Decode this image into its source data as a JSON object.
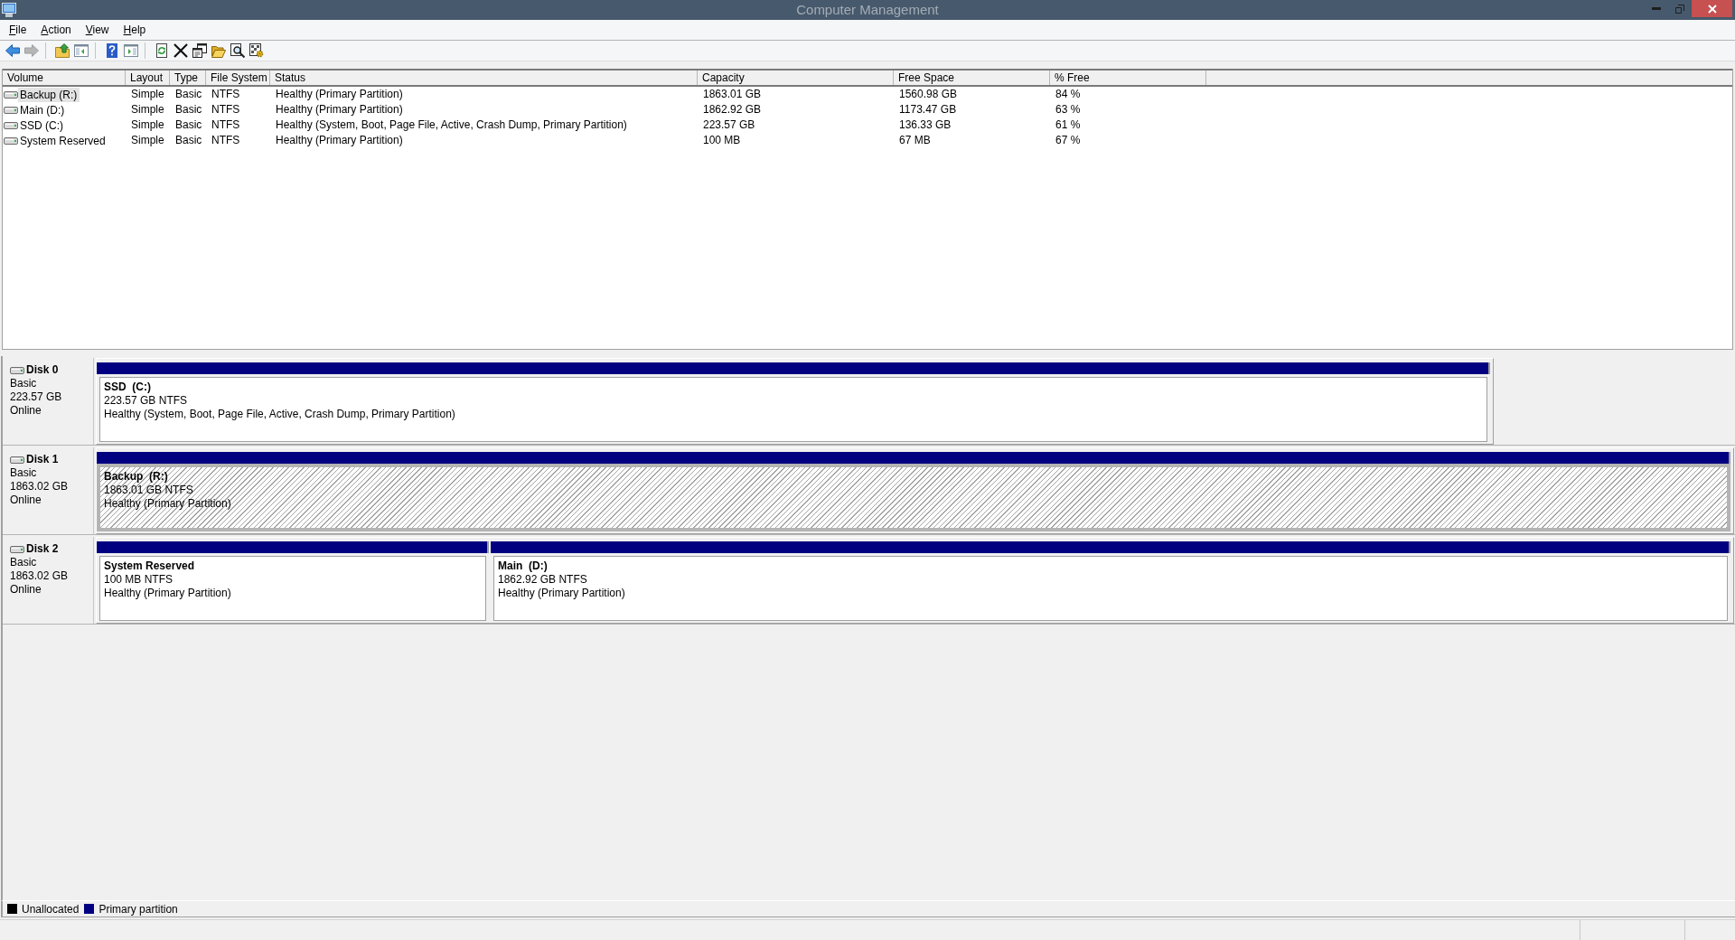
{
  "window": {
    "title": "Computer Management"
  },
  "menu": [
    {
      "label": "File"
    },
    {
      "label": "Action"
    },
    {
      "label": "View"
    },
    {
      "label": "Help"
    }
  ],
  "toolbar": {
    "groups": [
      [
        {
          "kind": "back",
          "disabled": false
        },
        {
          "kind": "forward",
          "disabled": true
        }
      ],
      [
        {
          "kind": "up",
          "disabled": false
        },
        {
          "kind": "console_tree",
          "disabled": false
        }
      ],
      [
        {
          "kind": "help",
          "disabled": false
        },
        {
          "kind": "action_pane",
          "disabled": false
        }
      ],
      [
        {
          "kind": "refresh",
          "disabled": false
        },
        {
          "kind": "delete",
          "disabled": false
        },
        {
          "kind": "properties",
          "disabled": false
        },
        {
          "kind": "open",
          "disabled": false
        },
        {
          "kind": "find",
          "disabled": false
        },
        {
          "kind": "options",
          "disabled": false
        }
      ]
    ]
  },
  "volume_table": {
    "columns": [
      "Volume",
      "Layout",
      "Type",
      "File System",
      "Status",
      "Capacity",
      "Free Space",
      "% Free"
    ],
    "rows": [
      {
        "selected": true,
        "cells": [
          "Backup (R:)",
          "Simple",
          "Basic",
          "NTFS",
          "Healthy (Primary Partition)",
          "1863.01 GB",
          "1560.98 GB",
          "84 %"
        ]
      },
      {
        "selected": false,
        "cells": [
          "Main (D:)",
          "Simple",
          "Basic",
          "NTFS",
          "Healthy (Primary Partition)",
          "1862.92 GB",
          "1173.47 GB",
          "63 %"
        ]
      },
      {
        "selected": false,
        "cells": [
          "SSD (C:)",
          "Simple",
          "Basic",
          "NTFS",
          "Healthy (System, Boot, Page File, Active, Crash Dump, Primary Partition)",
          "223.57 GB",
          "136.33 GB",
          "61 %"
        ]
      },
      {
        "selected": false,
        "cells": [
          "System Reserved",
          "Simple",
          "Basic",
          "NTFS",
          "Healthy (Primary Partition)",
          "100 MB",
          "67 MB",
          "67 %"
        ]
      }
    ]
  },
  "disks": [
    {
      "name": "Disk 0",
      "type": "Basic",
      "size": "223.57 GB",
      "state": "Online",
      "partitions": [
        {
          "name": "SSD  (C:)",
          "size": "223.57 GB NTFS",
          "status": "Healthy (System, Boot, Page File, Active, Crash Dump, Primary Partition)",
          "selected": false
        }
      ]
    },
    {
      "name": "Disk 1",
      "type": "Basic",
      "size": "1863.02 GB",
      "state": "Online",
      "partitions": [
        {
          "name": "Backup  (R:)",
          "size": "1863.01 GB NTFS",
          "status": "Healthy (Primary Partition)",
          "selected": true
        }
      ]
    },
    {
      "name": "Disk 2",
      "type": "Basic",
      "size": "1863.02 GB",
      "state": "Online",
      "partitions": [
        {
          "name": "System Reserved",
          "size": "100 MB NTFS",
          "status": "Healthy (Primary Partition)",
          "selected": false
        },
        {
          "name": "Main  (D:)",
          "size": "1862.92 GB NTFS",
          "status": "Healthy (Primary Partition)",
          "selected": false
        }
      ]
    }
  ],
  "legend": [
    {
      "label": "Unallocated",
      "color": "#000000"
    },
    {
      "label": "Primary partition",
      "color": "#000080"
    }
  ]
}
